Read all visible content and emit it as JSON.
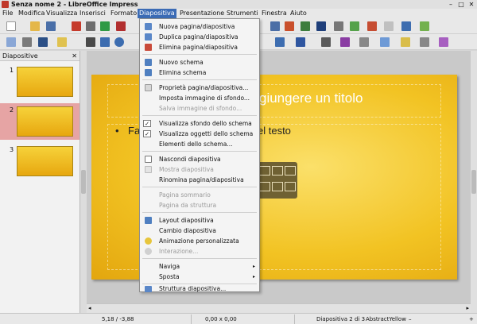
{
  "window": {
    "title": "Senza nome 2 - LibreOffice Impress",
    "controls": {
      "minimize": "–",
      "maximize": "□",
      "close": "✕"
    }
  },
  "menubar": [
    "File",
    "Modifica",
    "Visualizza",
    "Inserisci",
    "Formato",
    "Diapositiva",
    "Presentazione",
    "Strumenti",
    "Finestra",
    "Aiuto"
  ],
  "dropdown": {
    "items": [
      "Nuova pagina/diapositiva",
      "Duplica pagina/diapositiva",
      "Elimina pagina/diapositiva",
      "Nuovo schema",
      "Elimina schema",
      "Proprietà pagina/diapositiva...",
      "Imposta immagine di sfondo...",
      "Salva immagine di sfondo...",
      "Visualizza sfondo dello schema",
      "Visualizza oggetti dello schema",
      "Elementi dello schema...",
      "Nascondi diapositiva",
      "Mostra diapositiva",
      "Rinomina pagina/diapositiva",
      "Pagina sommario",
      "Pagina da struttura",
      "Layout diapositiva",
      "Cambio diapositiva",
      "Animazione personalizzata",
      "Interazione...",
      "Naviga",
      "Sposta",
      "Struttura diapositiva..."
    ],
    "check_mark": "✓",
    "submenu_arrow": "▸"
  },
  "slide_panel": {
    "title": "Diapositive",
    "close": "✕",
    "thumbs": [
      "1",
      "2",
      "3"
    ]
  },
  "slide": {
    "title_visible": "giungere un titolo",
    "bullet": "•",
    "body_visible_start": "Fa",
    "body_visible_end": "el testo"
  },
  "statusbar": {
    "position": "5,18 / -3,88",
    "size": "0,00 x 0,00",
    "slide_info": "Diapositiva 2 di 3",
    "master": "AbstractYellow",
    "zoom_minus": "–",
    "zoom_plus": "+"
  },
  "hscroll": {
    "left": "◂",
    "right": "▸"
  },
  "colors": {
    "accent": "#3b6bb5",
    "slide_yellow": "#f2c323",
    "selected_thumb": "#e6a4a4"
  }
}
